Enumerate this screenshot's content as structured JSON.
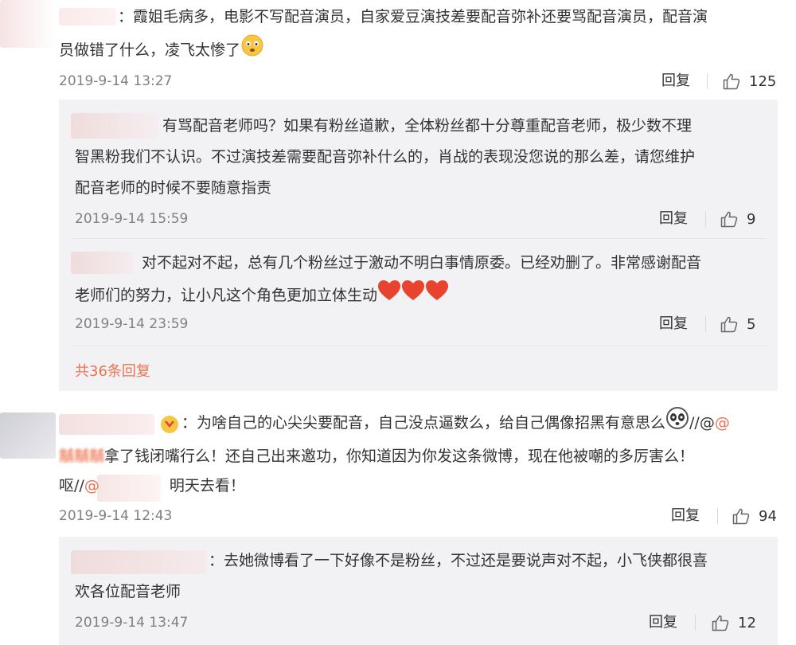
{
  "comments": [
    {
      "text_line1": "：霞姐毛病多，电影不写配音演员，自家爱豆演技差要配音弥补还要骂配音演员，配音演",
      "text_line2": "员做错了什么，凌飞太惨了",
      "time": "2019-9-14 13:27",
      "reply_label": "回复",
      "likes": "125",
      "sub_replies": [
        {
          "text_line1": "有骂配音老师吗？如果有粉丝道歉，全体粉丝都十分尊重配音老师，极少数不理",
          "text_line2": "智黑粉我们不认识。不过演技差需要配音弥补什么的，肖战的表现没您说的那么差，请您维护",
          "text_line3": "配音老师的时候不要随意指责",
          "time": "2019-9-14 15:59",
          "reply_label": "回复",
          "likes": "9"
        },
        {
          "text_line1": "对不起对不起，总有几个粉丝过于激动不明白事情原委。已经劝删了。非常感谢配音",
          "text_line2": "老师们的努力，让小凡这个角色更加立体生动",
          "time": "2019-9-14 23:59",
          "reply_label": "回复",
          "likes": "5"
        }
      ],
      "more_replies": "共36条回复"
    },
    {
      "text_line1_a": "：为啥自己的心尖尖要配音，自己没点逼数么，给自己偶像招黑有意思么",
      "text_line1_b": "//@",
      "text_line2_name": "黼黼黼",
      "text_line2": "拿了钱闭嘴行么！还自己出来邀功，你知道因为你发这条微博，现在他被嘲的多厉害么！",
      "text_line3_a": "呕//",
      "text_line3_at": "@",
      "text_line3_b": "明天去看！",
      "time": "2019-9-14 12:43",
      "reply_label": "回复",
      "likes": "94",
      "sub_replies": [
        {
          "text_line1": "：去她微博看了一下好像不是粉丝，不过还是要说声对不起，小飞侠都很喜",
          "text_line2": "欢各位配音老师",
          "time": "2019-9-14 13:47",
          "reply_label": "回复",
          "likes": "12"
        }
      ]
    }
  ],
  "colors": {
    "link": "#eb7350",
    "reply_box": "#f2f2f5",
    "time": "#808080",
    "heart": "#e8432f"
  },
  "icons": {
    "like": "thumbs-up-icon",
    "heart": "heart-icon",
    "emoji_worried": "worried-face-icon",
    "emoji_panda": "panda-face-icon"
  }
}
